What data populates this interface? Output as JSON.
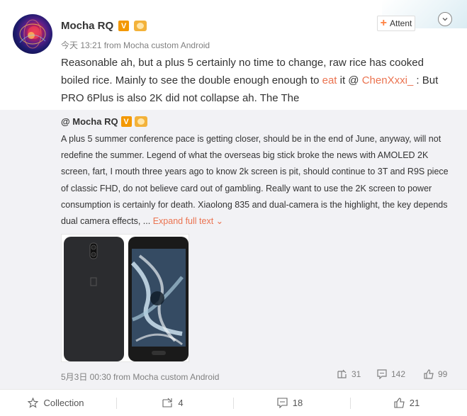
{
  "post": {
    "author": "Mocha RQ",
    "verified_badge": "V",
    "meta": "今天 13:21 from Mocha custom Android",
    "follow_label": "Attent",
    "follow_plus": "+",
    "text_part1": "Reasonable ah, but a plus 5 certainly no time to change, raw rice has cooked boiled rice. Mainly to see the double enough enough to ",
    "link_eat": "eat",
    "text_part2": " it @ ",
    "mention": "ChenXxxi_",
    "text_part3": " : But PRO 6Plus is also 2K did not collapse ah. The The"
  },
  "quoted": {
    "author": "@ Mocha RQ",
    "verified_badge": "V",
    "text": "A plus 5 summer conference pace is getting closer, should be in the end of June, anyway, will not redefine the summer. Legend of what the overseas big stick broke the news with AMOLED 2K screen, fart, I mouth three years ago to know 2k screen is pit, should continue to 3T and R9S piece of classic FHD, do not believe card out of gambling. Really want to use the 2K screen to power consumption is certainly for death. Xiaolong 835 and dual-camera is the highlight, the key depends dual camera effects, ... ",
    "expand_label": "Expand full text",
    "expand_chevron": "⌄",
    "meta": "5月3日 00:30 from Mocha custom Android",
    "reposts": "31",
    "comments": "142",
    "likes": "99"
  },
  "actions": {
    "collection": "Collection",
    "forward": "4",
    "comment": "18",
    "like": "21"
  },
  "colors": {
    "link": "#eb7350",
    "badge_v": "#f39800",
    "quoted_bg": "#f2f2f5"
  }
}
